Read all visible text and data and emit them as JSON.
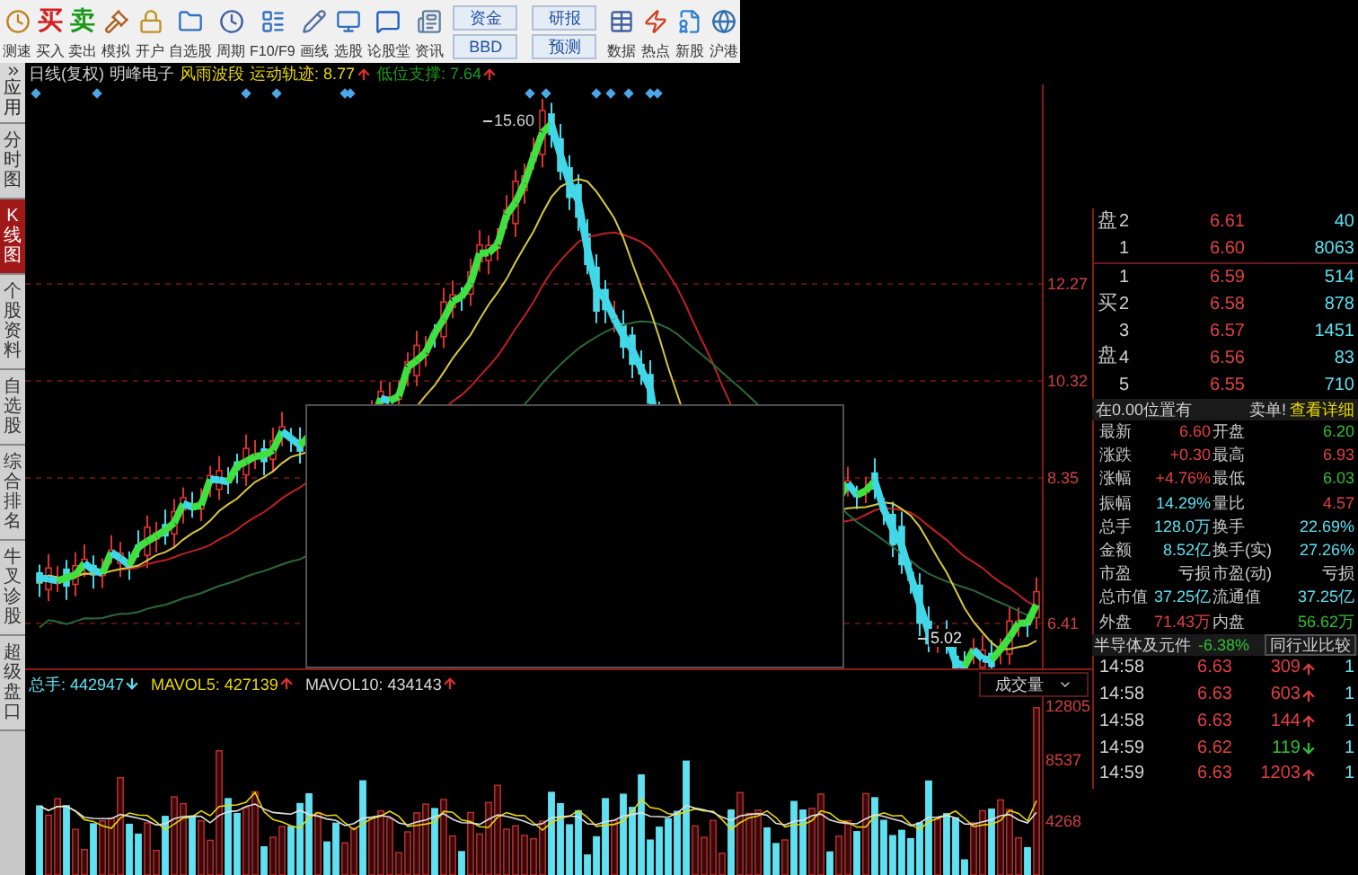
{
  "toolbar": [
    {
      "kind": "icon",
      "label": "测速"
    },
    {
      "kind": "glyph",
      "glyph": "买",
      "label": "买入",
      "color": "#d42020"
    },
    {
      "kind": "glyph",
      "glyph": "卖",
      "label": "卖出",
      "color": "#1a9a1a"
    },
    {
      "kind": "icon",
      "label": "模拟"
    },
    {
      "kind": "icon",
      "label": "开户"
    },
    {
      "kind": "icon",
      "label": "自选股"
    },
    {
      "kind": "icon",
      "label": "周期"
    },
    {
      "kind": "icon",
      "label": "F10/F9"
    },
    {
      "kind": "icon",
      "label": "画线"
    },
    {
      "kind": "icon",
      "label": "选股"
    },
    {
      "kind": "icon",
      "label": "论股堂"
    },
    {
      "kind": "icon",
      "label": "资讯"
    },
    {
      "kind": "pair",
      "top": "资金",
      "bottom": "BBD"
    },
    {
      "kind": "pair",
      "top": "研报",
      "bottom": "预测"
    },
    {
      "kind": "icon",
      "label": "数据"
    },
    {
      "kind": "icon",
      "label": "热点"
    },
    {
      "kind": "icon",
      "label": "新股"
    },
    {
      "kind": "icon",
      "label": "沪港"
    }
  ],
  "sidebar": {
    "apps": "应用",
    "tabs": [
      {
        "label": "分时图",
        "selected": false
      },
      {
        "label": "K线图",
        "selected": true
      },
      {
        "label": "个股资料",
        "selected": false
      },
      {
        "label": "自选股",
        "selected": false
      },
      {
        "label": "综合排名",
        "selected": false
      },
      {
        "label": "牛叉诊股",
        "selected": false
      },
      {
        "label": "超级盘口",
        "selected": false
      }
    ]
  },
  "chart_header": {
    "period": "日线(复权)",
    "stock": "明峰电子",
    "indicator": "风雨波段",
    "items": [
      {
        "label": "运动轨迹: 8.77",
        "color": "#e8d800",
        "rising": true
      },
      {
        "label": "低位支撑: 7.64",
        "color": "#1a9a1a",
        "rising": true
      }
    ]
  },
  "price_chart": {
    "high_label": "15.60",
    "low_label": "5.02",
    "axis_labels": [
      "12.27",
      "10.32",
      "8.35",
      "6.41"
    ]
  },
  "volume_header": {
    "items": [
      {
        "label": "总手: 442947",
        "color": "#5ee0f0",
        "rising": false
      },
      {
        "label": "MAVOL5: 427139",
        "color": "#e8d800",
        "rising": true
      },
      {
        "label": "MAVOL10: 434143",
        "color": "#d8d8d8",
        "rising": true
      }
    ],
    "selector": "成交量",
    "axis_labels": [
      "12805",
      "8537",
      "4268"
    ]
  },
  "order_book": {
    "sell_label": "盘",
    "buy_label": "买盘",
    "sell": [
      {
        "rank": "2",
        "price": "6.61",
        "volume": "40"
      },
      {
        "rank": "1",
        "price": "6.60",
        "volume": "8063"
      }
    ],
    "buy": [
      {
        "rank": "1",
        "price": "6.59",
        "volume": "514"
      },
      {
        "rank": "2",
        "price": "6.58",
        "volume": "878"
      },
      {
        "rank": "3",
        "price": "6.57",
        "volume": "1451"
      },
      {
        "rank": "4",
        "price": "6.56",
        "volume": "83"
      },
      {
        "rank": "5",
        "price": "6.55",
        "volume": "710"
      }
    ],
    "note": "在0.00位置有",
    "note_right": "卖单!",
    "link": "查看详细"
  },
  "stats": [
    {
      "label": "最新",
      "value": "6.60",
      "color": "#e04040"
    },
    {
      "label": "开盘",
      "value": "6.20",
      "color": "#30c030"
    },
    {
      "label": "涨跌",
      "value": "+0.30",
      "color": "#e04040"
    },
    {
      "label": "最高",
      "value": "6.93",
      "color": "#e04040"
    },
    {
      "label": "涨幅",
      "value": "+4.76%",
      "color": "#e04040"
    },
    {
      "label": "最低",
      "value": "6.03",
      "color": "#30c030"
    },
    {
      "label": "振幅",
      "value": "14.29%",
      "color": "#5ee0f0"
    },
    {
      "label": "量比",
      "value": "4.57",
      "color": "#e04040"
    },
    {
      "label": "总手",
      "value": "128.0万",
      "color": "#5ee0f0"
    },
    {
      "label": "换手",
      "value": "22.69%",
      "color": "#5ee0f0"
    },
    {
      "label": "金额",
      "value": "8.52亿",
      "color": "#5ee0f0"
    },
    {
      "label": "换手(实)",
      "value": "27.26%",
      "color": "#5ee0f0"
    },
    {
      "label": "市盈",
      "value": "亏损",
      "color": "#d8d8d8"
    },
    {
      "label": "市盈(动)",
      "value": "亏损",
      "color": "#d8d8d8"
    },
    {
      "label": "总市值",
      "value": "37.25亿",
      "color": "#5ee0f0"
    },
    {
      "label": "流通值",
      "value": "37.25亿",
      "color": "#5ee0f0"
    },
    {
      "label": "外盘",
      "value": "71.43万",
      "color": "#e04040"
    },
    {
      "label": "内盘",
      "value": "56.62万",
      "color": "#30c030"
    }
  ],
  "industry": {
    "name": "半导体及元件",
    "change": "-6.38%",
    "button": "同行业比较"
  },
  "ticks": [
    {
      "time": "14:58",
      "price": "6.63",
      "volume": "309",
      "rising": true,
      "column_4": "1"
    },
    {
      "time": "14:58",
      "price": "6.63",
      "volume": "603",
      "rising": true,
      "column_4": "1"
    },
    {
      "time": "14:58",
      "price": "6.63",
      "volume": "144",
      "rising": true,
      "column_4": "1"
    },
    {
      "time": "14:59",
      "price": "6.62",
      "volume": "119",
      "rising": false,
      "column_4": "1"
    },
    {
      "time": "14:59",
      "price": "6.63",
      "volume": "1203",
      "rising": true,
      "column_4": "1"
    }
  ]
}
